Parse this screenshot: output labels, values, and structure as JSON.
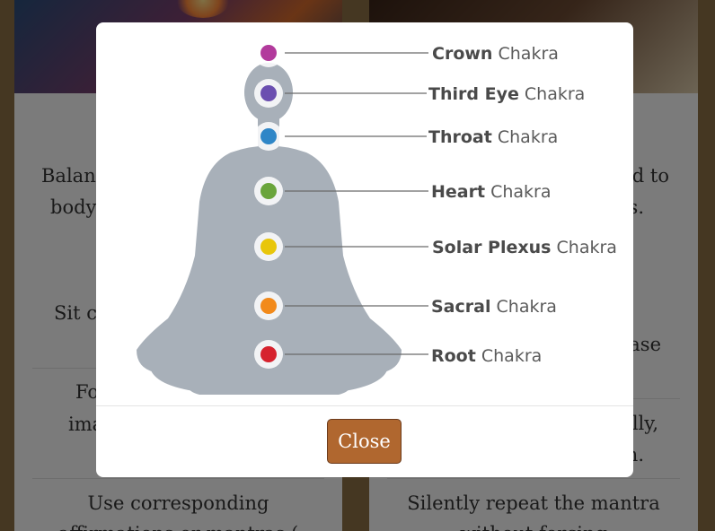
{
  "left_card": {
    "lines": [
      "Balanc",
      "body",
      "Sit co",
      "Fo",
      "ima",
      "Use corresponding",
      "affirmations or mantras (",
      "..."
    ]
  },
  "right_card": {
    "lines": [
      "d to",
      "s.",
      "ase",
      "lly,",
      "n.",
      "Silently repeat the mantra",
      "without forcing"
    ]
  },
  "modal": {
    "chakras": [
      {
        "bold": "Crown",
        "rest": " Chakra",
        "color": "#b23a9c"
      },
      {
        "bold": "Third Eye",
        "rest": " Chakra",
        "color": "#6b4fb0"
      },
      {
        "bold": "Throat",
        "rest": " Chakra",
        "color": "#2f86c7"
      },
      {
        "bold": "Heart",
        "rest": " Chakra",
        "color": "#6aa53c"
      },
      {
        "bold": "Solar Plexus",
        "rest": " Chakra",
        "color": "#e8c60b"
      },
      {
        "bold": "Sacral",
        "rest": " Chakra",
        "color": "#f28a1b"
      },
      {
        "bold": "Root",
        "rest": " Chakra",
        "color": "#d6222e"
      }
    ],
    "close_label": "Close"
  }
}
